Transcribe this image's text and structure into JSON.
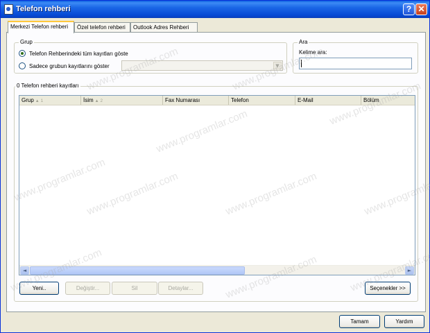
{
  "window": {
    "title": "Telefon rehberi",
    "help_label": "?",
    "close_label": "✕"
  },
  "tabs": [
    {
      "label": "Merkezi Telefon rehberi",
      "active": true
    },
    {
      "label": "Özel telefon rehberi",
      "active": false
    },
    {
      "label": "Outlook Adres Rehberi",
      "active": false
    }
  ],
  "grup": {
    "label": "Grup",
    "options": [
      {
        "label": "Telefon Rehberindeki tüm kayıtları göste",
        "checked": true
      },
      {
        "label": "Sadece grubun kayıtlarını göster",
        "checked": false
      }
    ],
    "combo_value": ""
  },
  "ara": {
    "label": "Ara",
    "field_label": "Kelime ara:",
    "value": ""
  },
  "records": {
    "label": "0 Telefon rehberi kayıtları",
    "columns": [
      {
        "label": "Grup",
        "sort": "1"
      },
      {
        "label": "İsim",
        "sort": "2"
      },
      {
        "label": "Fax Numarası",
        "sort": ""
      },
      {
        "label": "Telefon",
        "sort": ""
      },
      {
        "label": "E-Mail",
        "sort": ""
      },
      {
        "label": "Bölüm",
        "sort": ""
      }
    ],
    "rows": [],
    "scroll_left": "◄",
    "scroll_right": "►"
  },
  "actions": {
    "yeni": "Yeni..",
    "degistir": "Değiştir...",
    "sil": "Sil",
    "detaylar": "Detaylar...",
    "secenekler": "Seçenekler >>"
  },
  "footer": {
    "tamam": "Tamam",
    "yardim": "Yardım"
  },
  "watermark": "www.programlar.com"
}
